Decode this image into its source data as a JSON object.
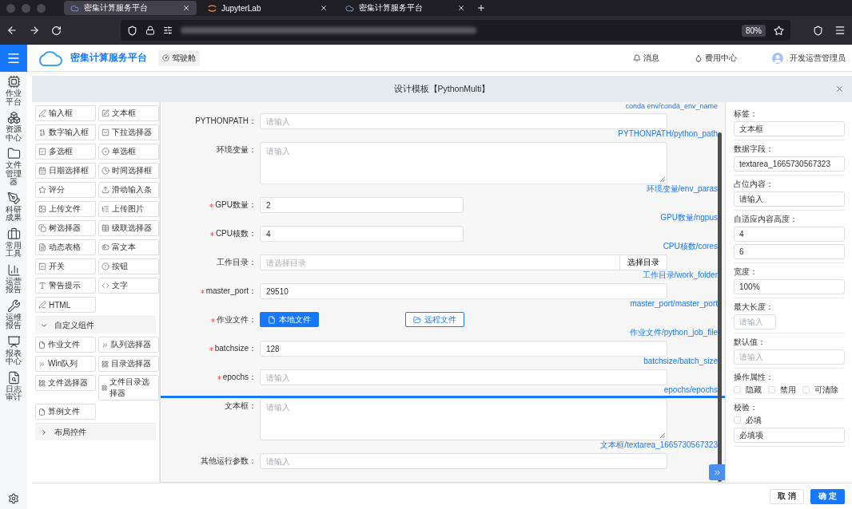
{
  "browser": {
    "tabs": [
      {
        "title": "密集计算服务平台",
        "selected": true
      },
      {
        "title": "JupyterLab",
        "selected": false
      },
      {
        "title": "密集计算服务平台",
        "selected": false
      }
    ],
    "zoom": "80%"
  },
  "header": {
    "title": "密集计算服务平台",
    "cockpit": "驾驶舱",
    "messages": "消息",
    "billing": "费用中心",
    "user": "开发运营管理员"
  },
  "nav": [
    {
      "label": "作业平台"
    },
    {
      "label": "资源中心"
    },
    {
      "label": "文件管理器"
    },
    {
      "label": "科研成果"
    },
    {
      "label": "常用工具"
    },
    {
      "label": "运营报告"
    },
    {
      "label": "运维报告"
    },
    {
      "label": "报表中心"
    },
    {
      "label": "日志审计"
    }
  ],
  "dialog": {
    "title": "设计模板【PythonMulti】",
    "palette": {
      "basic": [
        "输入框",
        "文本框",
        "数字输入框",
        "下拉选择器",
        "多选框",
        "单选框",
        "日期选择框",
        "时间选择框",
        "评分",
        "滑动输入条",
        "上传文件",
        "上传图片",
        "树选择器",
        "级联选择器",
        "动态表格",
        "富文本",
        "开关",
        "按钮",
        "警告提示",
        "文字",
        "HTML"
      ],
      "groups": [
        {
          "title": "自定义组件",
          "expanded": true,
          "items": [
            "作业文件",
            "队列选择器",
            "Win队列",
            "目录选择器",
            "文件选择器",
            "文件目录选择器",
            "算例文件"
          ]
        },
        {
          "title": "布局控件",
          "expanded": false
        }
      ]
    },
    "form": {
      "top_tag": "conda env/conda_env_name",
      "rows": [
        {
          "kind": "input",
          "label": "PYTHONPATH：",
          "required": false,
          "selected": false,
          "placeholder": "请输入",
          "tag": "PYTHONPATH/python_path"
        },
        {
          "kind": "textarea",
          "label": "环境变量：",
          "required": false,
          "selected": false,
          "placeholder": "请输入",
          "tag": "环境变量/env_paras"
        },
        {
          "kind": "number",
          "label": "GPU数量：",
          "required": true,
          "selected": false,
          "value": "2",
          "tag": "GPU数量/ngpus"
        },
        {
          "kind": "number",
          "label": "CPU核数：",
          "required": true,
          "selected": false,
          "value": "4",
          "tag": "CPU核数/cores"
        },
        {
          "kind": "folder",
          "label": "工作目录：",
          "required": false,
          "selected": false,
          "placeholder": "请选择目录",
          "button": "选择目录",
          "tag": "工作目录/work_folder"
        },
        {
          "kind": "input",
          "label": "master_port：",
          "required": true,
          "selected": false,
          "value": "29510",
          "tag": "master_port/master_port"
        },
        {
          "kind": "upload",
          "label": "作业文件：",
          "required": true,
          "selected": false,
          "buttons": [
            "本地文件",
            "远程文件"
          ],
          "tag": "作业文件/python_job_file"
        },
        {
          "kind": "input",
          "label": "batchsize：",
          "required": true,
          "selected": false,
          "value": "128",
          "tag": "batchsize/batch_size"
        },
        {
          "kind": "input",
          "label": "epochs：",
          "required": true,
          "selected": false,
          "placeholder": "请输入",
          "tag": "epochs/epochs"
        },
        {
          "kind": "textarea",
          "label": "文本框：",
          "required": false,
          "selected": true,
          "placeholder": "请输入",
          "tag": "文本框/textarea_1665730567323"
        },
        {
          "kind": "input",
          "label": "其他运行参数：",
          "required": false,
          "selected": false,
          "placeholder": "请输入"
        }
      ]
    },
    "props": [
      {
        "kind": "input",
        "label": "标签：",
        "value": "文本框"
      },
      {
        "kind": "input",
        "label": "数据字段：",
        "value": "textarea_1665730567323"
      },
      {
        "kind": "input",
        "label": "占位内容：",
        "value": "请输入"
      },
      {
        "kind": "pair",
        "label": "自适应内容高度：",
        "values": [
          "4",
          "6"
        ]
      },
      {
        "kind": "input",
        "label": "宽度：",
        "value": "100%"
      },
      {
        "kind": "short",
        "label": "最大长度：",
        "placeholder": "请输入"
      },
      {
        "kind": "input",
        "label": "默认值：",
        "placeholder": "请输入"
      },
      {
        "kind": "checks",
        "label": "操作属性：",
        "options": [
          {
            "label": "隐藏",
            "checked": false
          },
          {
            "label": "禁用",
            "checked": false
          },
          {
            "label": "可清除",
            "checked": false
          }
        ]
      },
      {
        "kind": "validate",
        "label": "校验：",
        "options": [
          {
            "label": "必填",
            "checked": false
          }
        ],
        "value": "必填项"
      }
    ],
    "footer": {
      "cancel": "取 消",
      "ok": "确 定"
    }
  }
}
